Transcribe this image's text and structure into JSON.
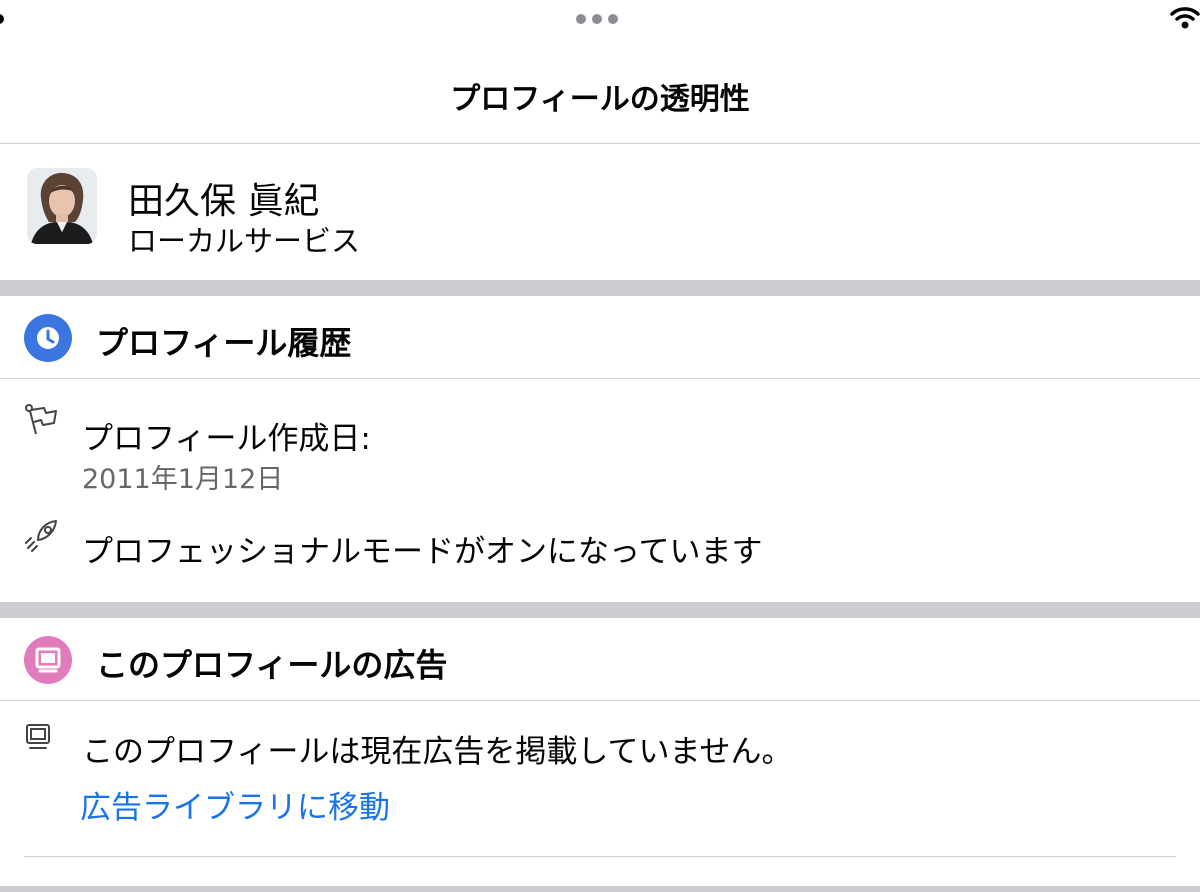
{
  "header": {
    "title": "プロフィールの透明性"
  },
  "profile": {
    "name": "田久保 眞紀",
    "category": "ローカルサービス"
  },
  "history_section": {
    "title": "プロフィール履歴",
    "icon": "clock-icon",
    "icon_color": "#3b75e0",
    "created_label": "プロフィール作成日:",
    "created_date": "2011年1月12日",
    "professional_mode": "プロフェッショナルモードがオンになっています"
  },
  "ads_section": {
    "title": "このプロフィールの広告",
    "icon": "monitor-icon",
    "icon_color": "#e27bbd",
    "status": "このプロフィールは現在広告を掲載していません。",
    "library_link": "広告ライブラリに移動"
  },
  "colors": {
    "link": "#1a73e8",
    "divider_band": "#cbcdd3",
    "secondary_text": "#65676b"
  }
}
